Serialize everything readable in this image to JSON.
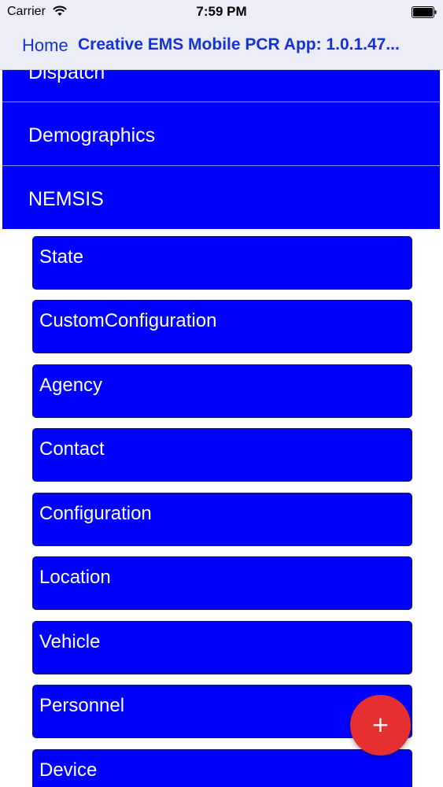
{
  "status_bar": {
    "carrier": "Carrier",
    "time": "7:59 PM"
  },
  "nav": {
    "back_label": "Home",
    "title": "Creative EMS Mobile PCR App: 1.0.1.47..."
  },
  "sections": [
    {
      "label": "Dispatch"
    },
    {
      "label": "Demographics"
    },
    {
      "label": "NEMSIS"
    }
  ],
  "nemsis_items": [
    {
      "label": "State"
    },
    {
      "label": "CustomConfiguration"
    },
    {
      "label": "Agency"
    },
    {
      "label": "Contact"
    },
    {
      "label": "Configuration"
    },
    {
      "label": "Location"
    },
    {
      "label": "Vehicle"
    },
    {
      "label": "Personnel"
    },
    {
      "label": "Device"
    }
  ],
  "fab": {
    "icon": "plus-icon",
    "symbol": "+"
  },
  "colors": {
    "row_blue": "#0000ff",
    "nav_tint": "#1532d8",
    "fab_red": "#e52f31"
  }
}
